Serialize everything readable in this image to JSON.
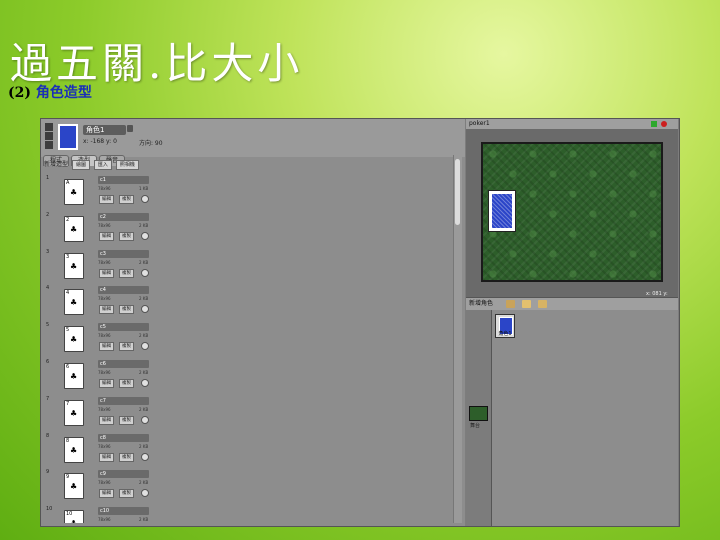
{
  "slide": {
    "title": "過五關.比大小",
    "subtitle_num": "(2)",
    "subtitle_text": "角色造型"
  },
  "sprite": {
    "name": "角色1",
    "x": "x: -168",
    "y": "y: 0",
    "direction": "方向: 90",
    "thumb_color": "#2b45c8"
  },
  "tabs": [
    "程式",
    "造型",
    "聲音"
  ],
  "active_tab": 1,
  "new_costume": {
    "label": "新增造型",
    "buttons": [
      "繪圖",
      "匯入",
      "照相機"
    ]
  },
  "costume_buttons": {
    "edit": "編輯",
    "copy": "複製"
  },
  "costumes": [
    {
      "num": "1",
      "name": "c1",
      "rank": "A",
      "pip": "♣",
      "size": "78x96",
      "bytes": "1 KB"
    },
    {
      "num": "2",
      "name": "c2",
      "rank": "2",
      "pip": "♣",
      "size": "78x96",
      "bytes": "2 KB"
    },
    {
      "num": "3",
      "name": "c3",
      "rank": "3",
      "pip": "♣",
      "size": "78x96",
      "bytes": "2 KB"
    },
    {
      "num": "4",
      "name": "c4",
      "rank": "4",
      "pip": "♣",
      "size": "78x96",
      "bytes": "2 KB"
    },
    {
      "num": "5",
      "name": "c5",
      "rank": "5",
      "pip": "♣",
      "size": "78x96",
      "bytes": "2 KB"
    },
    {
      "num": "6",
      "name": "c6",
      "rank": "6",
      "pip": "♣",
      "size": "78x96",
      "bytes": "2 KB"
    },
    {
      "num": "7",
      "name": "c7",
      "rank": "7",
      "pip": "♣",
      "size": "78x96",
      "bytes": "2 KB"
    },
    {
      "num": "8",
      "name": "c8",
      "rank": "8",
      "pip": "♣",
      "size": "78x96",
      "bytes": "2 KB"
    },
    {
      "num": "9",
      "name": "c9",
      "rank": "9",
      "pip": "♣",
      "size": "78x96",
      "bytes": "2 KB"
    },
    {
      "num": "10",
      "name": "c10",
      "rank": "10",
      "pip": "♣",
      "size": "78x96",
      "bytes": "2 KB"
    }
  ],
  "stage": {
    "title": "poker1",
    "info": "x: 081  y: 120"
  },
  "sprites_panel": {
    "label": "新增角色",
    "sprite_label": "角色1",
    "stage_label": "舞台"
  }
}
